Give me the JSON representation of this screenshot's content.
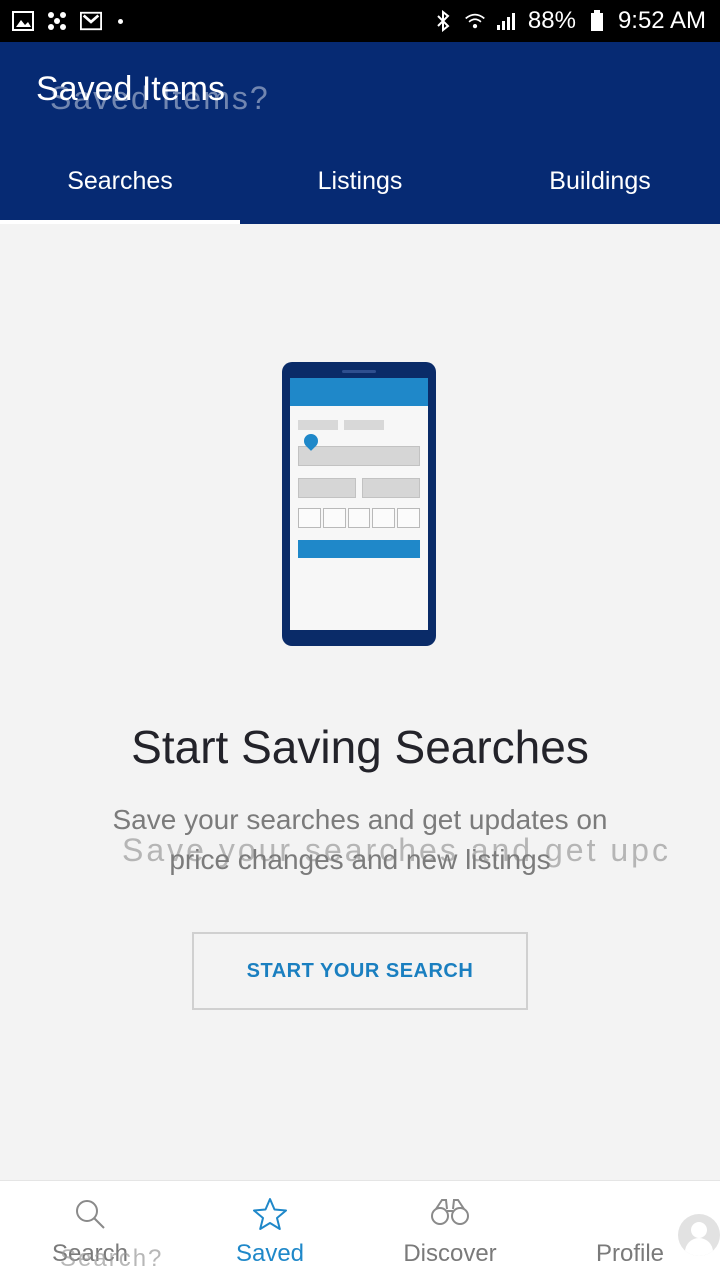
{
  "status_bar": {
    "battery": "88%",
    "time": "9:52 AM",
    "left_icons": [
      "image-icon",
      "fan-icon",
      "gmail-icon",
      "dot-icon"
    ],
    "right_icons": [
      "bluetooth-icon",
      "wifi-icon",
      "signal-icon",
      "battery-icon"
    ]
  },
  "header": {
    "title": "Saved Items",
    "ghost_title": "Saved Items?",
    "tabs": [
      {
        "label": "Searches",
        "active": true
      },
      {
        "label": "Listings",
        "active": false
      },
      {
        "label": "Buildings",
        "active": false
      }
    ]
  },
  "empty_state": {
    "headline": "Start Saving Searches",
    "subtext": "Save your searches and get updates on price changes and new listings",
    "ghost_subtext": "Save your searches and get upc",
    "cta_label": "START YOUR SEARCH",
    "illustration": "phone-search-form-illustration"
  },
  "bottom_nav": {
    "ghost_label": "Search?",
    "items": [
      {
        "label": "Search",
        "icon": "search-icon",
        "active": false
      },
      {
        "label": "Saved",
        "icon": "star-icon",
        "active": true
      },
      {
        "label": "Discover",
        "icon": "binoculars-icon",
        "active": false
      },
      {
        "label": "Profile",
        "icon": "avatar-icon",
        "active": false
      }
    ]
  },
  "colors": {
    "header_bg": "#062a73",
    "accent": "#1f88c9",
    "body_bg": "#f3f3f3"
  }
}
